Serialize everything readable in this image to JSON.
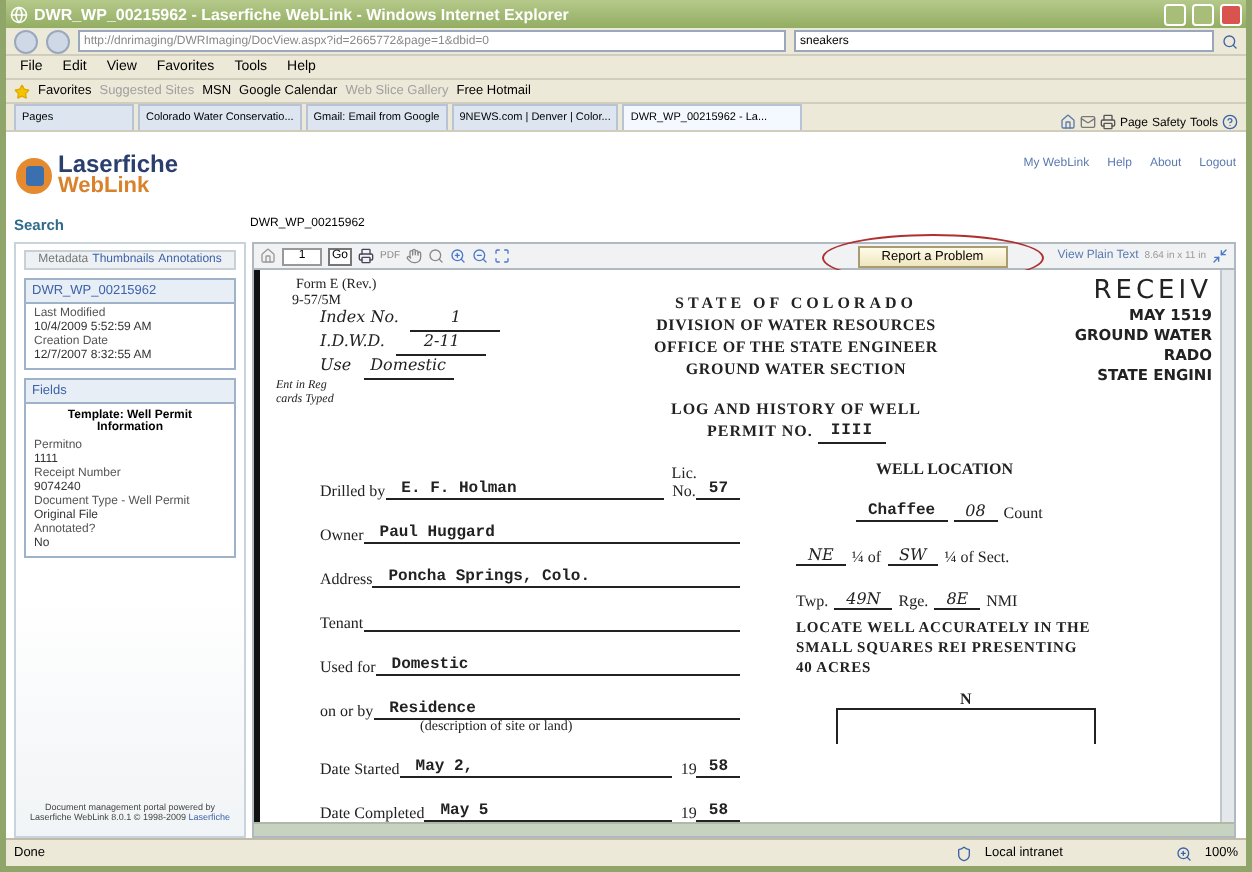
{
  "window": {
    "title": "DWR_WP_00215962 - Laserfiche WebLink - Windows Internet Explorer"
  },
  "address_bar": {
    "url": "http://dnrimaging/DWRImaging/DocView.aspx?id=2665772&page=1&dbid=0",
    "search_value": "sneakers"
  },
  "menu": [
    "File",
    "Edit",
    "View",
    "Favorites",
    "Tools",
    "Help"
  ],
  "favorites_bar": {
    "label": "Favorites",
    "items": [
      {
        "label": "Suggested Sites",
        "disabled": true
      },
      {
        "label": "MSN",
        "disabled": false
      },
      {
        "label": "Google Calendar",
        "disabled": false
      },
      {
        "label": "Web Slice Gallery",
        "disabled": true
      },
      {
        "label": "Free Hotmail",
        "disabled": false
      }
    ]
  },
  "tabs": [
    {
      "label": "Pages",
      "selected": false
    },
    {
      "label": "Colorado Water Conservatio...",
      "selected": false
    },
    {
      "label": "Gmail: Email from Google",
      "selected": false
    },
    {
      "label": "9NEWS.com | Denver | Color...",
      "selected": false
    },
    {
      "label": "DWR_WP_00215962 - La...",
      "selected": true
    }
  ],
  "command_bar": [
    "Page",
    "Safety",
    "Tools"
  ],
  "page": {
    "logo": {
      "name": "Laserfiche",
      "product": "WebLink"
    },
    "header_links": [
      "My WebLink",
      "Help",
      "About",
      "Logout"
    ],
    "search_label": "Search",
    "document_title": "DWR_WP_00215962",
    "sidebar": {
      "tabs": [
        {
          "label": "Metadata",
          "selected": true
        },
        {
          "label": "Thumbnails",
          "selected": false
        },
        {
          "label": "Annotations",
          "selected": false
        }
      ],
      "metadata": {
        "title": "DWR_WP_00215962",
        "items": [
          {
            "label": "Last Modified",
            "value": "10/4/2009 5:52:59 AM"
          },
          {
            "label": "Creation Date",
            "value": "12/7/2007 8:32:55 AM"
          }
        ]
      },
      "fields": {
        "title": "Fields",
        "template": "Template: Well Permit Information",
        "items": [
          {
            "label": "Permitno",
            "value": "1111"
          },
          {
            "label": "Receipt Number",
            "value": "9074240"
          },
          {
            "label": "Document Type - Well Permit",
            "value": "Original File"
          },
          {
            "label": "Annotated?",
            "value": "No"
          }
        ]
      },
      "footer": {
        "text": "Document management portal powered by Laserfiche WebLink 8.0.1 © 1998-2009",
        "link": "Laserfiche"
      }
    },
    "viewer": {
      "page_number": "1",
      "go": "Go",
      "pdf": "PDF",
      "report_button": "Report a Problem",
      "plain_text_link": "View Plain Text",
      "page_size": "8.64 in x 11 in",
      "document": {
        "form_id": [
          "Form E (Rev.)",
          "9-57/5M"
        ],
        "handwritten": [
          {
            "label": "Index No.",
            "value": "1"
          },
          {
            "label": "I.D.W.D.",
            "value": "2-11"
          },
          {
            "label": "Use",
            "value": "Domestic"
          }
        ],
        "margin_note": [
          "Ent in Reg",
          "cards Typed"
        ],
        "heading": [
          "STATE OF COLORADO",
          "DIVISION OF WATER RESOURCES",
          "OFFICE OF THE STATE ENGINEER",
          "GROUND WATER SECTION"
        ],
        "form_title": "LOG AND HISTORY OF WELL",
        "permit_label": "PERMIT NO.",
        "permit_value": "IIII",
        "stamp": [
          "RECEIV",
          "MAY 1519",
          "GROUND WATER",
          "RADO",
          "STATE ENGINI"
        ],
        "license": {
          "lic": "Lic.",
          "label": "No.",
          "value": "57"
        },
        "fields": [
          {
            "label": "Drilled by",
            "value": "E. F. Holman"
          },
          {
            "label": "Owner",
            "value": "Paul Huggard"
          },
          {
            "label": "Address",
            "value": "Poncha Springs, Colo."
          },
          {
            "label": "Tenant"
          },
          {
            "label": "Used for",
            "value": "Domestic"
          },
          {
            "label": "on or by",
            "value": "Residence",
            "note": "(description of site or land)"
          },
          {
            "label": "Date Started",
            "value": "May 2,",
            "year": "19",
            "year_value": "58"
          },
          {
            "label": "Date Completed",
            "value": "May 5",
            "year": "19",
            "year_value": "58"
          }
        ],
        "location": {
          "title": "WELL LOCATION",
          "county_value": "Chaffee",
          "county_code": "08",
          "county_label": "Count",
          "quarter1": "NE",
          "of1": "¼ of",
          "quarter2": "SW",
          "of2": "¼ of Sect.",
          "twp_label": "Twp.",
          "twp_value": "49N",
          "rge_label": "Rge.",
          "rge_value": "8E",
          "meridian": "NMI",
          "instructions": "LOCATE WELL ACCURATELY IN THE SMALL SQUARES REI PRESENTING 40 ACRES",
          "north": "N"
        }
      }
    }
  },
  "status_bar": {
    "text": "Done",
    "zone": "Local intranet",
    "zoom": "100%"
  }
}
